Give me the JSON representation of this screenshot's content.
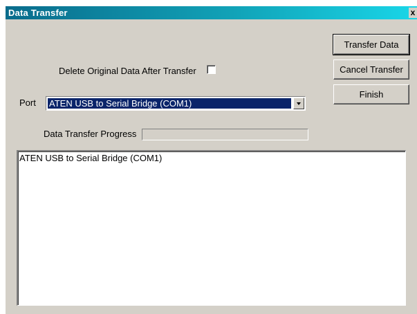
{
  "window": {
    "title": "Data Transfer",
    "close_glyph": "x"
  },
  "buttons": {
    "transfer": "Transfer Data",
    "cancel": "Cancel Transfer",
    "finish": "Finish"
  },
  "options": {
    "delete_label": "Delete Original Data After Transfer",
    "delete_checked": false
  },
  "port": {
    "label": "Port",
    "selected": "ATEN USB to Serial Bridge (COM1)"
  },
  "progress": {
    "label": "Data Transfer Progress",
    "percent": 0
  },
  "log": {
    "lines": [
      "ATEN USB to Serial Bridge (COM1)"
    ]
  },
  "colors": {
    "title_gradient_start": "#0a6c8c",
    "title_gradient_end": "#19d6e8",
    "selection": "#0a246a",
    "face": "#d4d0c8"
  }
}
